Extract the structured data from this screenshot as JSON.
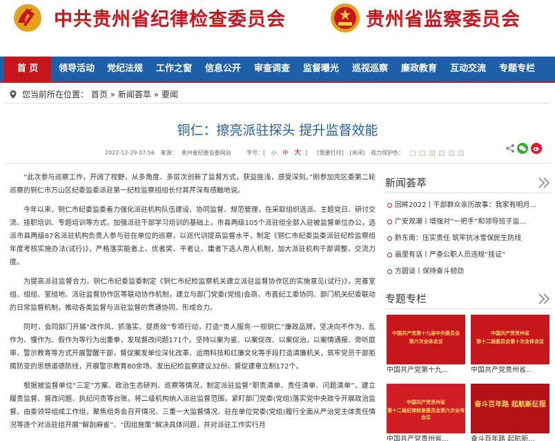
{
  "header": {
    "left_title": "中共贵州省纪律检查委员会",
    "right_title": "贵州省监察委员会",
    "left_emblem_icon": "party-emblem-icon",
    "right_emblem_icon": "national-emblem-icon"
  },
  "nav": {
    "items": [
      {
        "label": "首 页",
        "active": true
      },
      {
        "label": "领导活动"
      },
      {
        "label": "党纪法规"
      },
      {
        "label": "工作之窗"
      },
      {
        "label": "信息公开"
      },
      {
        "label": "审查调查"
      },
      {
        "label": "监督曝光"
      },
      {
        "label": "巡视巡察"
      },
      {
        "label": "廉政教育"
      },
      {
        "label": "互动交流"
      },
      {
        "label": "专题专栏"
      }
    ]
  },
  "breadcrumb": {
    "prefix": "您当前所在位置：",
    "items": [
      "首页",
      "新闻荟萃",
      "要闻"
    ],
    "separator": "»"
  },
  "article": {
    "title": "铜仁：擦亮派驻探头 提升监督效能",
    "date": "2022-12-29 07:56",
    "source_label": "来源：",
    "source": "贵州省纪委监委网站",
    "font_label": "字号：[",
    "font_small": "小",
    "font_mid": "中",
    "font_large": "大",
    "font_close": "]",
    "print": "[我要打印]",
    "close": "[关闭]",
    "vision_label": "视力保护色：",
    "vision_colors": [
      "#fafafa",
      "#fdf3e0",
      "#e6f1dd",
      "#e3eef9",
      "#f2e6f2",
      "#eeeeee"
    ],
    "paragraphs": [
      "“此次参与巡察工作，开阔了视野，从多角度、多层次创新了监督方式，获益匪浅，感受深刻。”刚参加完区委第二轮巡察的铜仁市万山区纪委监委派驻第一纪检监察组组长付其芹深有感触地说。",
      "今年以来，铜仁市纪委监委着力强化派驻机构队伍建设、协同监督、规范管理，在采取组织选派、主题党日、研讨交流、挂职培训、专题培训等方式，加强派驻干部学习培训的基础上，市县两级105个派驻组全部入驻被监督单位办公，选派市县两级87名派驻机构负责人参与驻在单位的巡察，以巡代训提高监督水平，制定《铜仁市纪委监委派驻纪检监察组年度考核实施办法(试行)》，严格落实能者上、优者奖、平者让、庸者下选人用人机制，加大派驻机构干部调整、交流力度。",
      "为提高派驻监督合力。铜仁市纪委监委制定《铜仁市纪检监察机关建立派驻监督协作区的实施意见(试行)》，完善室组、组组、室组地、派驻监督协作区等联动协作机制，建立与部门党委(党组)会商、市直纪工委协同、部门机关纪委联动的日常监督机制，推动各类监督与派驻监督的贯通协同、形成合力。",
      "同时，会同部门开展“改作风、抓落实、提质效”专项行动，打造“贵人服务·一视铜仁”廉政品牌，坚决向不作为、乱作为、慢作为、假作为等行为出重拳，发现督改问题171个。坚持以案为鉴、以案促改、以案促治，以案情通报、旁听庭审、警示教育等方式开展警醒干部，督促案发单位深化改革、运用科技和红廉文化等手段打造清廉机关，筑牢党员干部拒腐防变的思想道德防线，开展警示教育80余场、发出纪检监察建议32份、督促建章立制172个。",
      "根据被监督单位“三定”方案、政治生态研判、巡察等情况，制定派驻监督“职责清单、责任清单、问题清单”，建立履责监督、督改问题、执纪问责等台账，将二级机构纳入派驻监督范围，紧盯部门党委(党组)落实党中央政令开展政治监督。由委领导组成工作组，聚焦组务会召开情况、三重一大监督情况、驻在单位党委(党组)履行全面从严治党主体责任情况等逐个对派驻组开展“解剖麻雀”、“因组施策”解决具体问题，并对派驻工作实行月"
    ]
  },
  "sidebar": {
    "news_heading": "新闻荟萃",
    "news_items": [
      "回眸2022丨干部群众亲历故事：我家有明月...",
      "广安观潮丨增强对“一把手”和领导班子监...",
      "黔东南：压实责任 筑牢抗冰雪保民生防线",
      "画里有话丨严查公职人员违规“挂证”",
      "方圆谈丨保持奋斗韧劲"
    ],
    "topics_heading": "专题专栏",
    "topics": [
      {
        "label": "中国共产党第十九...",
        "caption_top": "中国共产党第十九届中央委员会",
        "caption_bottom": "第六次全体会议",
        "bg": "#c8161d"
      },
      {
        "label": "中国共产党贵州省...",
        "caption_top": "中国共产党贵州省",
        "caption_bottom": "第十二届委员会第十次全体会议",
        "bg": "#c8161d"
      },
      {
        "label": "中国共产党贵州省...",
        "caption_top": "中国共产党贵州省",
        "caption_bottom": "第十二届纪律检查委员会第六次全体会议",
        "bg": "#d01e24"
      },
      {
        "label": "奋斗百年路 起航新...",
        "caption_top": "奋斗百年路 起航新征程",
        "caption_bottom": "",
        "bg": "#b51218"
      }
    ]
  },
  "colors": {
    "brand_red": "#c8161d",
    "nav_blue": "#1d5fa8",
    "title_blue": "#1d5fa8"
  }
}
